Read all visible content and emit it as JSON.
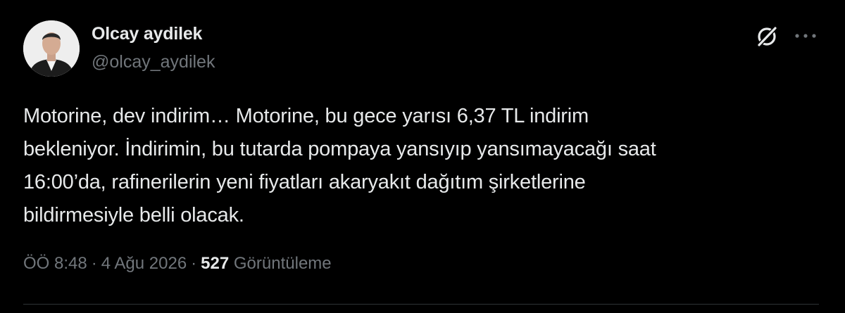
{
  "author": {
    "display_name": "Olcay aydilek",
    "handle": "@olcay_aydilek"
  },
  "tweet": {
    "text": "Motorine, dev indirim… Motorine, bu gece yarısı 6,37 TL indirim\nbekleniyor. İndirimin, bu tutarda pompaya yansıyıp yansımayacağı saat\n16:00’da, rafinerilerin yeni fiyatları akaryakıt dağıtım şirketlerine\nbildirmesiyle belli olacak."
  },
  "meta": {
    "time": "ÖÖ 8:48",
    "separator": "·",
    "date": "4 Ağu 2026",
    "views_count": "527",
    "views_label": "Görüntüleme"
  },
  "icons": {
    "grok": "grok-icon",
    "more": "more-horizontal-icon"
  },
  "colors": {
    "background": "#000000",
    "primary_text": "#e7e9ea",
    "secondary_text": "#71767b",
    "divider": "#2f3336"
  }
}
